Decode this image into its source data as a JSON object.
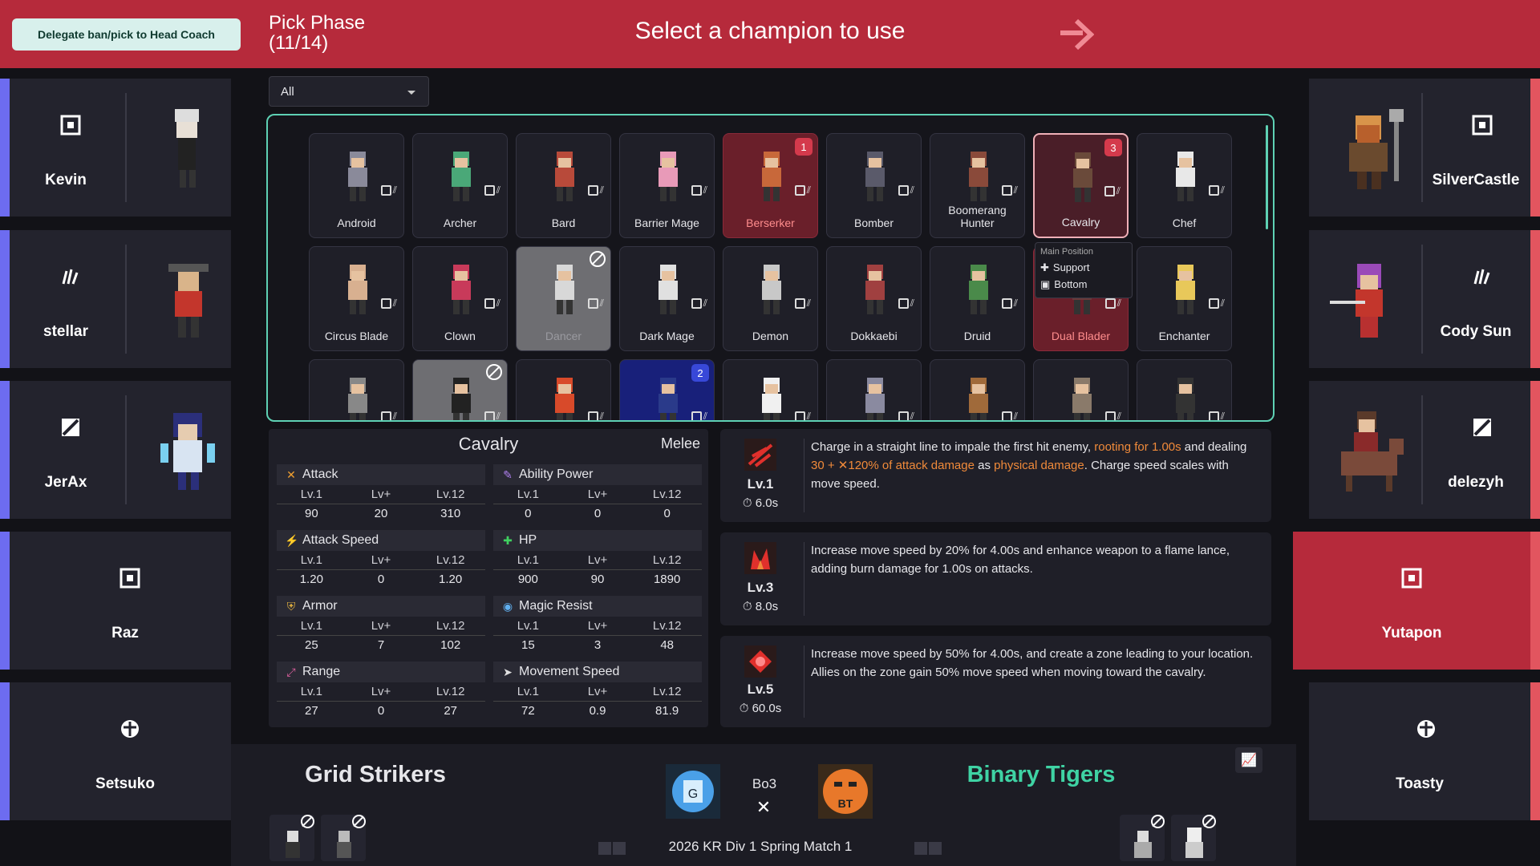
{
  "topbar": {
    "delegate_label": "Delegate ban/pick to Head Coach",
    "phase_title": "Pick Phase",
    "phase_count": "(11/14)",
    "instruction": "Select a champion to use"
  },
  "left_players": [
    {
      "name": "Kevin",
      "role_icon": "bottom-icon"
    },
    {
      "name": "stellar",
      "role_icon": "jungle-icon"
    },
    {
      "name": "JerAx",
      "role_icon": "mid-icon"
    },
    {
      "name": "Raz",
      "role_icon": "bottom-icon"
    },
    {
      "name": "Setsuko",
      "role_icon": "support-icon"
    }
  ],
  "right_players": [
    {
      "name": "SilverCastle",
      "role_icon": "bottom-icon"
    },
    {
      "name": "Cody Sun",
      "role_icon": "jungle-icon"
    },
    {
      "name": "delezyh",
      "role_icon": "mid-icon"
    },
    {
      "name": "Yutapon",
      "role_icon": "bottom-icon"
    },
    {
      "name": "Toasty",
      "role_icon": "support-icon"
    }
  ],
  "filter": {
    "value": "All"
  },
  "champions": [
    {
      "name": "Android"
    },
    {
      "name": "Archer"
    },
    {
      "name": "Bard"
    },
    {
      "name": "Barrier Mage"
    },
    {
      "name": "Berserker",
      "pick": "1"
    },
    {
      "name": "Bomber"
    },
    {
      "name": "Boomerang Hunter"
    },
    {
      "name": "Cavalry",
      "pick": "3"
    },
    {
      "name": "Chef"
    },
    {
      "name": "Circus Blade"
    },
    {
      "name": "Clown"
    },
    {
      "name": "Dancer"
    },
    {
      "name": "Dark Mage"
    },
    {
      "name": "Demon"
    },
    {
      "name": "Dokkaebi"
    },
    {
      "name": "Druid"
    },
    {
      "name": "Dual Blader"
    },
    {
      "name": "Enchanter"
    },
    {
      "name": ""
    },
    {
      "name": ""
    },
    {
      "name": ""
    },
    {
      "name": "",
      "pick": "2"
    },
    {
      "name": ""
    },
    {
      "name": ""
    },
    {
      "name": ""
    },
    {
      "name": ""
    },
    {
      "name": ""
    }
  ],
  "tooltip": {
    "title": "Main Position",
    "items": [
      "Support",
      "Bottom"
    ]
  },
  "stats": {
    "champion": "Cavalry",
    "type": "Melee",
    "col_labels": [
      "Lv.1",
      "Lv+",
      "Lv.12"
    ],
    "blocks": [
      {
        "label": "Attack",
        "icon": "attack-icon",
        "values": [
          "90",
          "20",
          "310"
        ]
      },
      {
        "label": "Ability Power",
        "icon": "ability-power-icon",
        "values": [
          "0",
          "0",
          "0"
        ]
      },
      {
        "label": "Attack Speed",
        "icon": "attack-speed-icon",
        "values": [
          "1.20",
          "0",
          "1.20"
        ]
      },
      {
        "label": "HP",
        "icon": "hp-icon",
        "values": [
          "900",
          "90",
          "1890"
        ]
      },
      {
        "label": "Armor",
        "icon": "armor-icon",
        "values": [
          "25",
          "7",
          "102"
        ]
      },
      {
        "label": "Magic Resist",
        "icon": "magic-resist-icon",
        "values": [
          "15",
          "3",
          "48"
        ]
      },
      {
        "label": "Range",
        "icon": "range-icon",
        "values": [
          "27",
          "0",
          "27"
        ]
      },
      {
        "label": "Movement Speed",
        "icon": "movement-speed-icon",
        "values": [
          "72",
          "0.9",
          "81.9"
        ]
      }
    ]
  },
  "skills": [
    {
      "level": "Lv.1",
      "cooldown": "6.0s",
      "text_parts": [
        "Charge in a straight line to impale the first hit enemy, ",
        "rooting for 1.00s",
        " and dealing ",
        "30 + ",
        "120% of attack damage",
        " as ",
        "physical damage",
        ". Charge speed scales with move speed."
      ]
    },
    {
      "level": "Lv.3",
      "cooldown": "8.0s",
      "text": "Increase move speed by 20% for 4.00s and enhance weapon to a flame lance, adding burn damage for 1.00s on attacks."
    },
    {
      "level": "Lv.5",
      "cooldown": "60.0s",
      "text": "Increase move speed by 50% for 4.00s, and create a zone leading to your location. Allies on the zone gain 50% move speed when moving toward the cavalry."
    }
  ],
  "match": {
    "team_left": "Grid Strikers",
    "team_right": "Binary Tigers",
    "format": "Bo3",
    "name": "2026 KR Div 1 Spring Match 1",
    "colors": {
      "team_right": "#3fd3a4"
    }
  }
}
